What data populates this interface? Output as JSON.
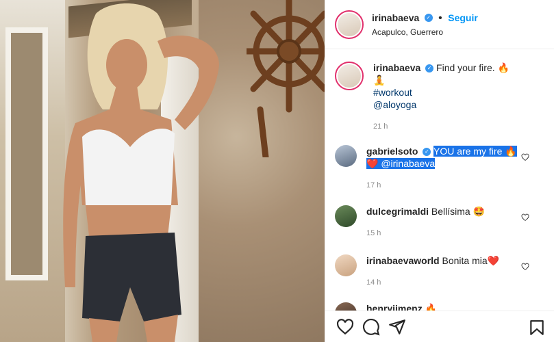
{
  "header": {
    "username": "irinabaeva",
    "follow_label": "Seguir",
    "location": "Acapulco, Guerrero",
    "separator": "•"
  },
  "caption": {
    "username": "irinabaeva",
    "text": "Find your fire. 🔥🧘",
    "hashtag": "#workout",
    "mention": "@aloyoga",
    "time": "21 h"
  },
  "comments": [
    {
      "username": "gabrielsoto",
      "text_highlighted": "YOU are my fire 🔥 ❤️ @irinabaeva",
      "time": "17 h"
    },
    {
      "username": "dulcegrimaldi",
      "text": "Bellísima 🤩",
      "time": "15 h"
    },
    {
      "username": "irinabaevaworld",
      "text": "Bonita mia❤️",
      "time": "14 h"
    },
    {
      "username": "henryjimenz",
      "text": "🔥"
    }
  ],
  "icons": {
    "verified": "verified-icon",
    "like": "heart-icon",
    "comment": "comment-icon",
    "share": "share-icon",
    "save": "bookmark-icon"
  },
  "colors": {
    "follow_blue": "#0095f6",
    "verified_blue": "#3897f0",
    "highlight": "#1a73e8",
    "time_gray": "#8e8e8e"
  }
}
